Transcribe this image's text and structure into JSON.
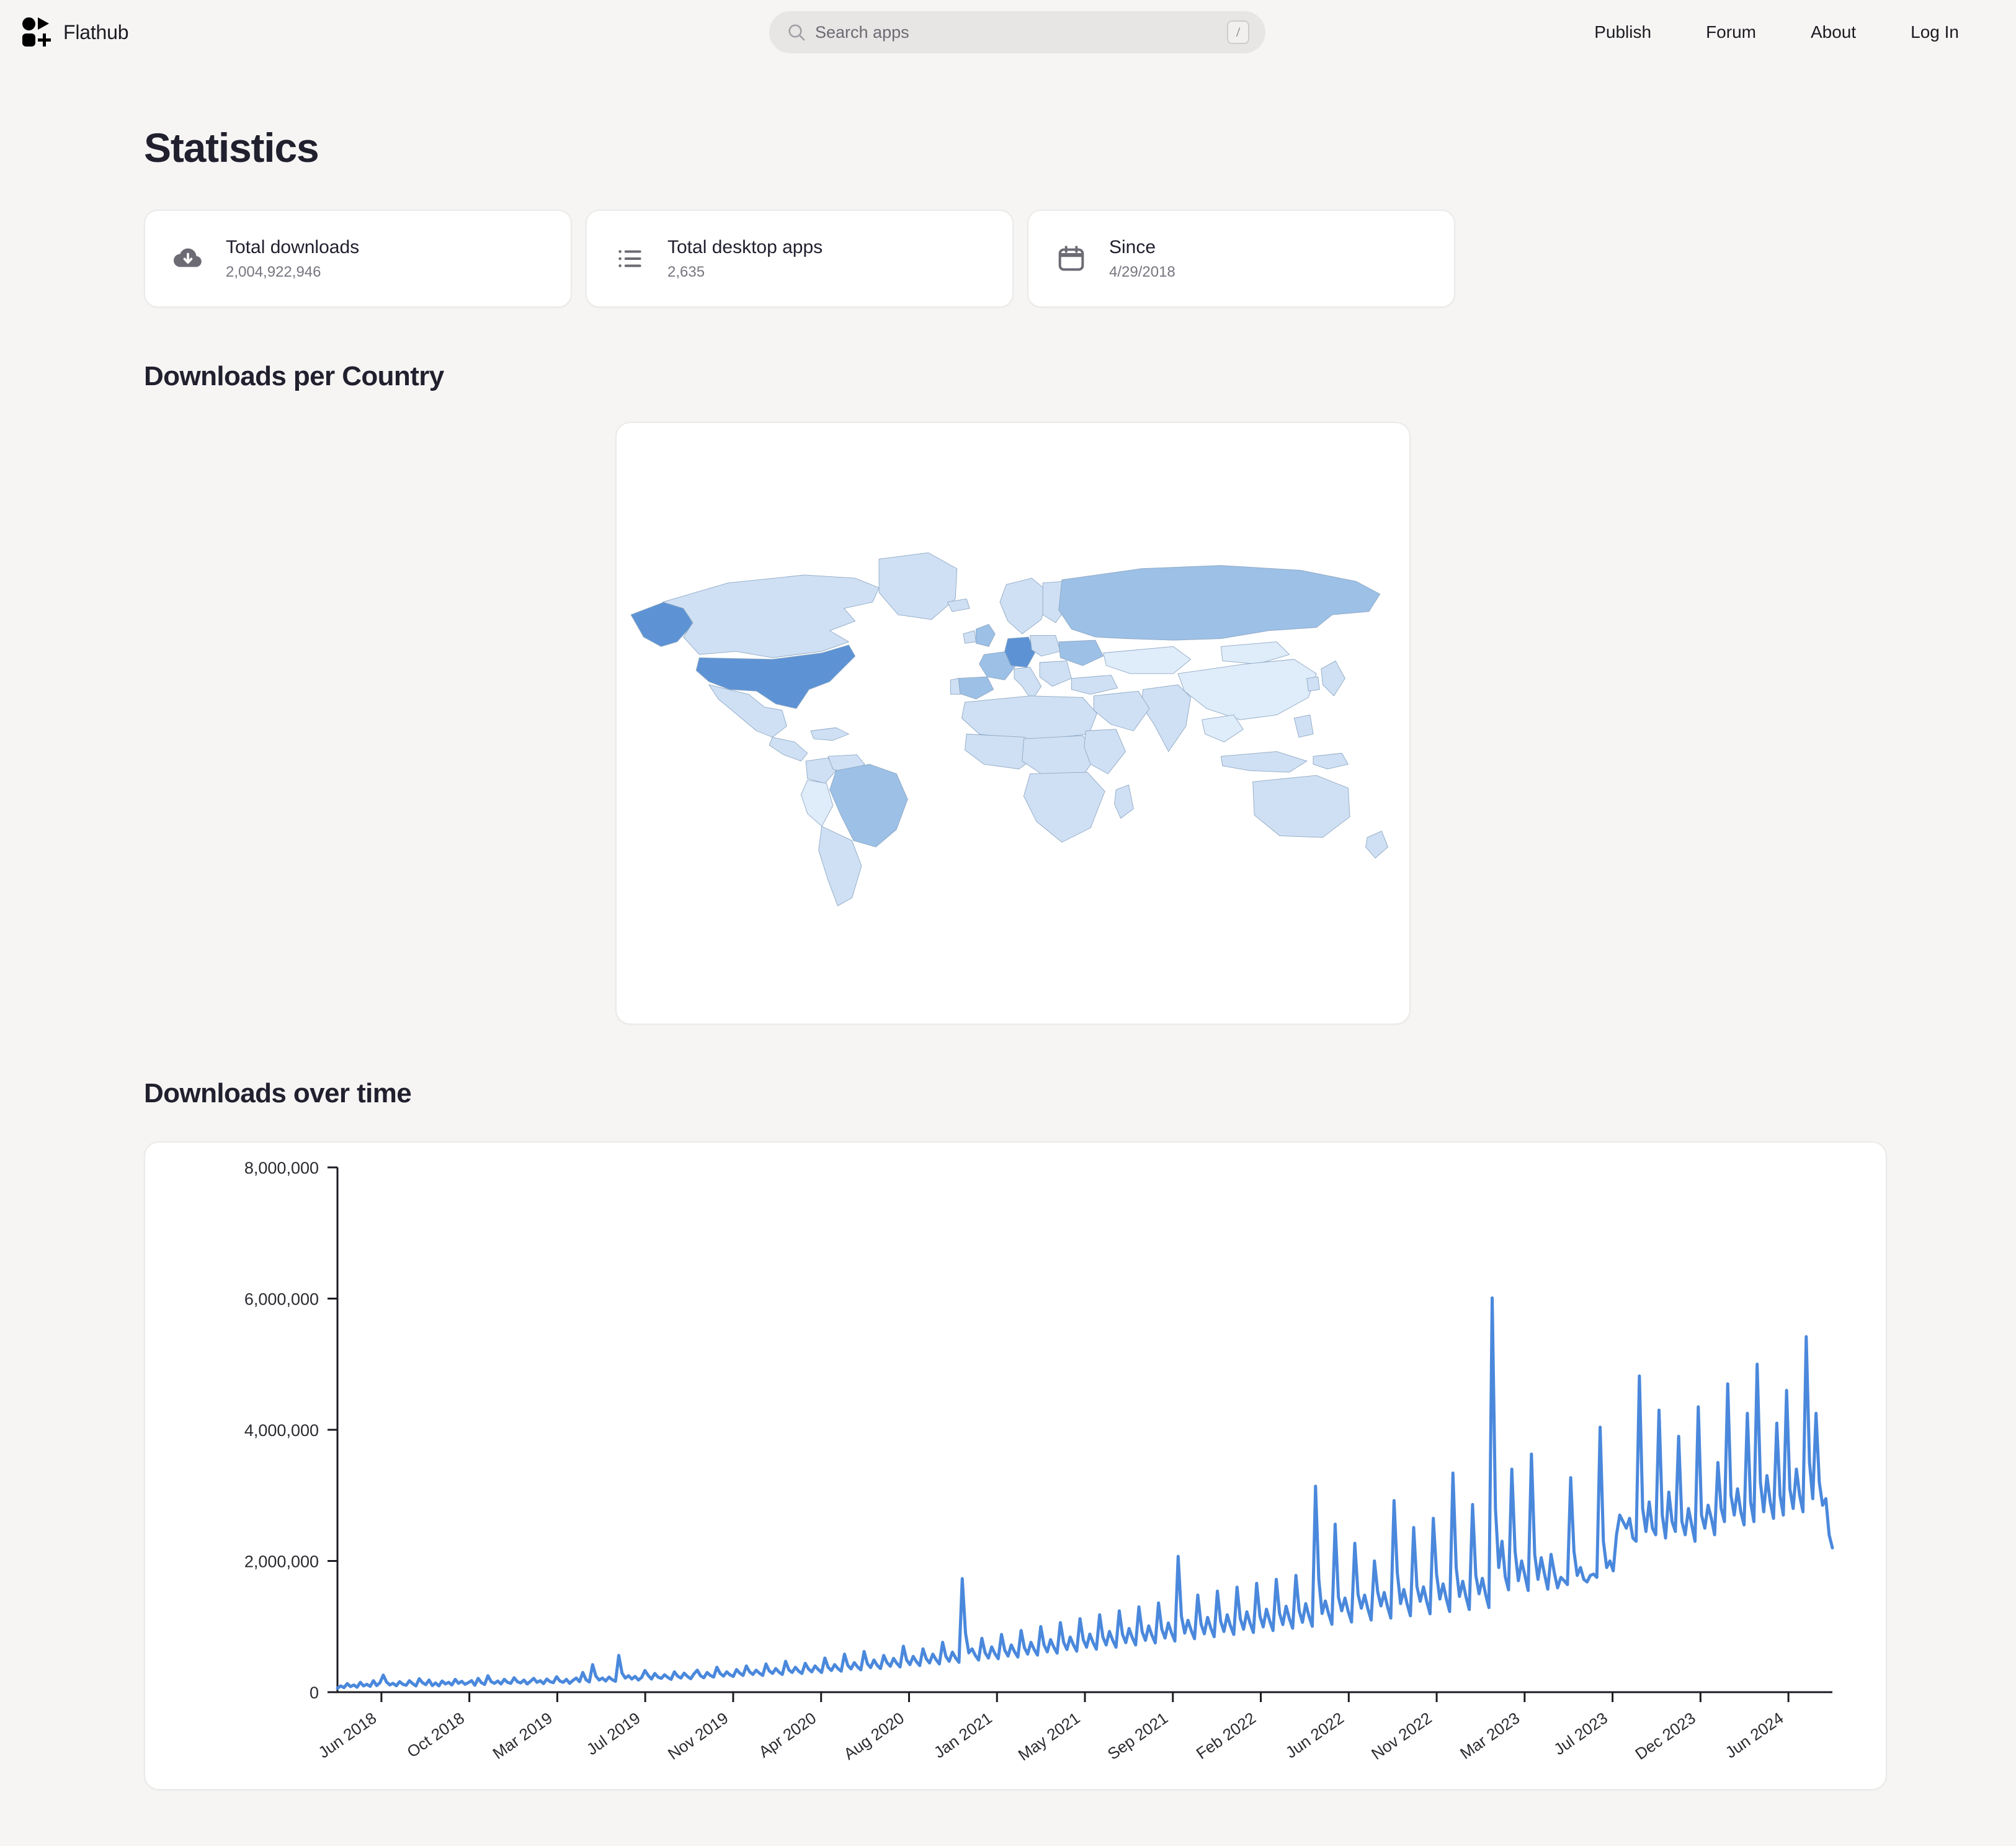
{
  "header": {
    "brand": "Flathub",
    "search": {
      "placeholder": "Search apps",
      "shortcut": "/"
    },
    "nav": [
      {
        "label": "Publish"
      },
      {
        "label": "Forum"
      },
      {
        "label": "About"
      },
      {
        "label": "Log In"
      }
    ]
  },
  "page": {
    "title": "Statistics",
    "cards": [
      {
        "icon": "cloud-download-icon",
        "label": "Total downloads",
        "value": "2,004,922,946"
      },
      {
        "icon": "list-icon",
        "label": "Total desktop apps",
        "value": "2,635"
      },
      {
        "icon": "calendar-icon",
        "label": "Since",
        "value": "4/29/2018"
      }
    ],
    "sections": [
      {
        "title": "Downloads per Country"
      },
      {
        "title": "Downloads over time"
      }
    ]
  },
  "colors": {
    "accent_line": "#4a88dc",
    "map_max": "#5d93d4",
    "map_mid": "#9cc0e6",
    "map_low": "#cfe0f4",
    "map_min": "#dfecfa",
    "page_bg": "#f6f5f4",
    "card_bg": "#ffffff",
    "text": "#21202e"
  },
  "chart_data": {
    "type": "line",
    "title": "Downloads over time",
    "xlabel": "",
    "ylabel": "",
    "ylim": [
      0,
      8000000
    ],
    "yticks": [
      0,
      2000000,
      4000000,
      6000000,
      8000000
    ],
    "ytick_labels": [
      "0",
      "2,000,000",
      "4,000,000",
      "6,000,000",
      "8,000,000"
    ],
    "grid": false,
    "legend": "none",
    "xtick_labels": [
      "Jun 2018",
      "Oct 2018",
      "Mar 2019",
      "Jul 2019",
      "Nov 2019",
      "Apr 2020",
      "Aug 2020",
      "Jan 2021",
      "May 2021",
      "Sep 2021",
      "Feb 2022",
      "Jun 2022",
      "Nov 2022",
      "Mar 2023",
      "Jul 2023",
      "Dec 2023",
      "Jun 2024"
    ],
    "series": [
      {
        "name": "Downloads",
        "color": "#4a88dc",
        "values": [
          60000,
          95000,
          70000,
          130000,
          85000,
          110000,
          75000,
          150000,
          95000,
          120000,
          88000,
          175000,
          100000,
          145000,
          260000,
          155000,
          110000,
          135000,
          98000,
          160000,
          120000,
          105000,
          175000,
          130000,
          95000,
          205000,
          145000,
          115000,
          185000,
          100000,
          140000,
          96000,
          170000,
          125000,
          150000,
          110000,
          195000,
          135000,
          165000,
          120000,
          145000,
          175000,
          105000,
          210000,
          145000,
          118000,
          250000,
          160000,
          135000,
          170000,
          125000,
          195000,
          150000,
          135000,
          220000,
          160000,
          140000,
          185000,
          125000,
          165000,
          210000,
          150000,
          175000,
          130000,
          200000,
          160000,
          145000,
          235000,
          170000,
          150000,
          195000,
          135000,
          180000,
          215000,
          160000,
          300000,
          190000,
          155000,
          420000,
          245000,
          185000,
          215000,
          170000,
          230000,
          190000,
          165000,
          560000,
          290000,
          215000,
          250000,
          200000,
          240000,
          185000,
          225000,
          330000,
          255000,
          200000,
          285000,
          230000,
          210000,
          265000,
          225000,
          195000,
          310000,
          245000,
          215000,
          290000,
          240000,
          205000,
          280000,
          335000,
          250000,
          220000,
          300000,
          255000,
          230000,
          380000,
          285000,
          245000,
          310000,
          265000,
          240000,
          345000,
          290000,
          255000,
          400000,
          310000,
          270000,
          335000,
          290000,
          255000,
          430000,
          325000,
          285000,
          360000,
          305000,
          270000,
          470000,
          340000,
          300000,
          380000,
          320000,
          285000,
          440000,
          355000,
          310000,
          400000,
          345000,
          300000,
          520000,
          380000,
          330000,
          420000,
          360000,
          320000,
          580000,
          410000,
          355000,
          450000,
          385000,
          340000,
          620000,
          435000,
          375000,
          490000,
          410000,
          360000,
          560000,
          450000,
          395000,
          515000,
          440000,
          385000,
          700000,
          490000,
          420000,
          545000,
          465000,
          405000,
          660000,
          510000,
          445000,
          580000,
          495000,
          430000,
          760000,
          545000,
          470000,
          610000,
          520000,
          455000,
          1730000,
          900000,
          600000,
          660000,
          560000,
          490000,
          820000,
          600000,
          520000,
          690000,
          585000,
          510000,
          880000,
          640000,
          550000,
          720000,
          615000,
          535000,
          940000,
          680000,
          580000,
          760000,
          650000,
          565000,
          1000000,
          720000,
          615000,
          800000,
          685000,
          595000,
          1060000,
          760000,
          650000,
          840000,
          720000,
          625000,
          1120000,
          800000,
          685000,
          885000,
          755000,
          655000,
          1180000,
          840000,
          720000,
          925000,
          790000,
          685000,
          1240000,
          880000,
          755000,
          970000,
          830000,
          720000,
          1300000,
          920000,
          790000,
          1010000,
          865000,
          750000,
          1360000,
          960000,
          825000,
          1055000,
          900000,
          780000,
          2070000,
          1160000,
          900000,
          1095000,
          940000,
          815000,
          1480000,
          1040000,
          890000,
          1140000,
          975000,
          845000,
          1540000,
          1080000,
          925000,
          1180000,
          1010000,
          880000,
          1600000,
          1120000,
          960000,
          1225000,
          1050000,
          910000,
          1660000,
          1160000,
          995000,
          1265000,
          1085000,
          940000,
          1720000,
          1200000,
          1030000,
          1310000,
          1120000,
          975000,
          1780000,
          1240000,
          1065000,
          1350000,
          1160000,
          1005000,
          3140000,
          1720000,
          1200000,
          1390000,
          1195000,
          1035000,
          2560000,
          1450000,
          1240000,
          1435000,
          1230000,
          1070000,
          2270000,
          1490000,
          1280000,
          1480000,
          1270000,
          1100000,
          2000000,
          1530000,
          1315000,
          1520000,
          1305000,
          1130000,
          2920000,
          1820000,
          1350000,
          1565000,
          1345000,
          1165000,
          2510000,
          1610000,
          1385000,
          1605000,
          1380000,
          1195000,
          2650000,
          1800000,
          1420000,
          1650000,
          1420000,
          1230000,
          3340000,
          1900000,
          1460000,
          1690000,
          1450000,
          1260000,
          2860000,
          1780000,
          1500000,
          1735000,
          1490000,
          1290000,
          6010000,
          2800000,
          1900000,
          2300000,
          1760000,
          1560000,
          3400000,
          2150000,
          1700000,
          2000000,
          1780000,
          1550000,
          3630000,
          2100000,
          1720000,
          2050000,
          1800000,
          1570000,
          2100000,
          1820000,
          1590000,
          1750000,
          1700000,
          1640000,
          3270000,
          2150000,
          1780000,
          1900000,
          1720000,
          1680000,
          1780000,
          1800000,
          1750000,
          4040000,
          2300000,
          1900000,
          2000000,
          1850000,
          2400000,
          2700000,
          2600000,
          2500000,
          2650000,
          2350000,
          2300000,
          4820000,
          2800000,
          2450000,
          2900000,
          2500000,
          2400000,
          4300000,
          2700000,
          2350000,
          3050000,
          2600000,
          2450000,
          3900000,
          2600000,
          2400000,
          2800000,
          2550000,
          2300000,
          4350000,
          2700000,
          2500000,
          2850000,
          2650000,
          2400000,
          3500000,
          2800000,
          2600000,
          4700000,
          3000000,
          2700000,
          3100000,
          2750000,
          2550000,
          4250000,
          2900000,
          2600000,
          5000000,
          3200000,
          2750000,
          3300000,
          2900000,
          2650000,
          4100000,
          3000000,
          2700000,
          4600000,
          3100000,
          2800000,
          3400000,
          3000000,
          2750000,
          5420000,
          3500000,
          2950000,
          4250000,
          3200000,
          2850000,
          2950000,
          2400000,
          2200000
        ]
      }
    ]
  },
  "map_data": {
    "type": "choropleth",
    "legend": "none",
    "highlights": [
      {
        "country": "United States",
        "level": "max"
      },
      {
        "country": "Germany",
        "level": "max"
      },
      {
        "country": "Brazil",
        "level": "mid"
      },
      {
        "country": "Russia",
        "level": "mid"
      },
      {
        "country": "France",
        "level": "mid"
      },
      {
        "country": "Canada",
        "level": "low"
      },
      {
        "country": "Mexico",
        "level": "low"
      },
      {
        "country": "China",
        "level": "min"
      },
      {
        "country": "India",
        "level": "low"
      },
      {
        "country": "Australia",
        "level": "low"
      }
    ]
  }
}
